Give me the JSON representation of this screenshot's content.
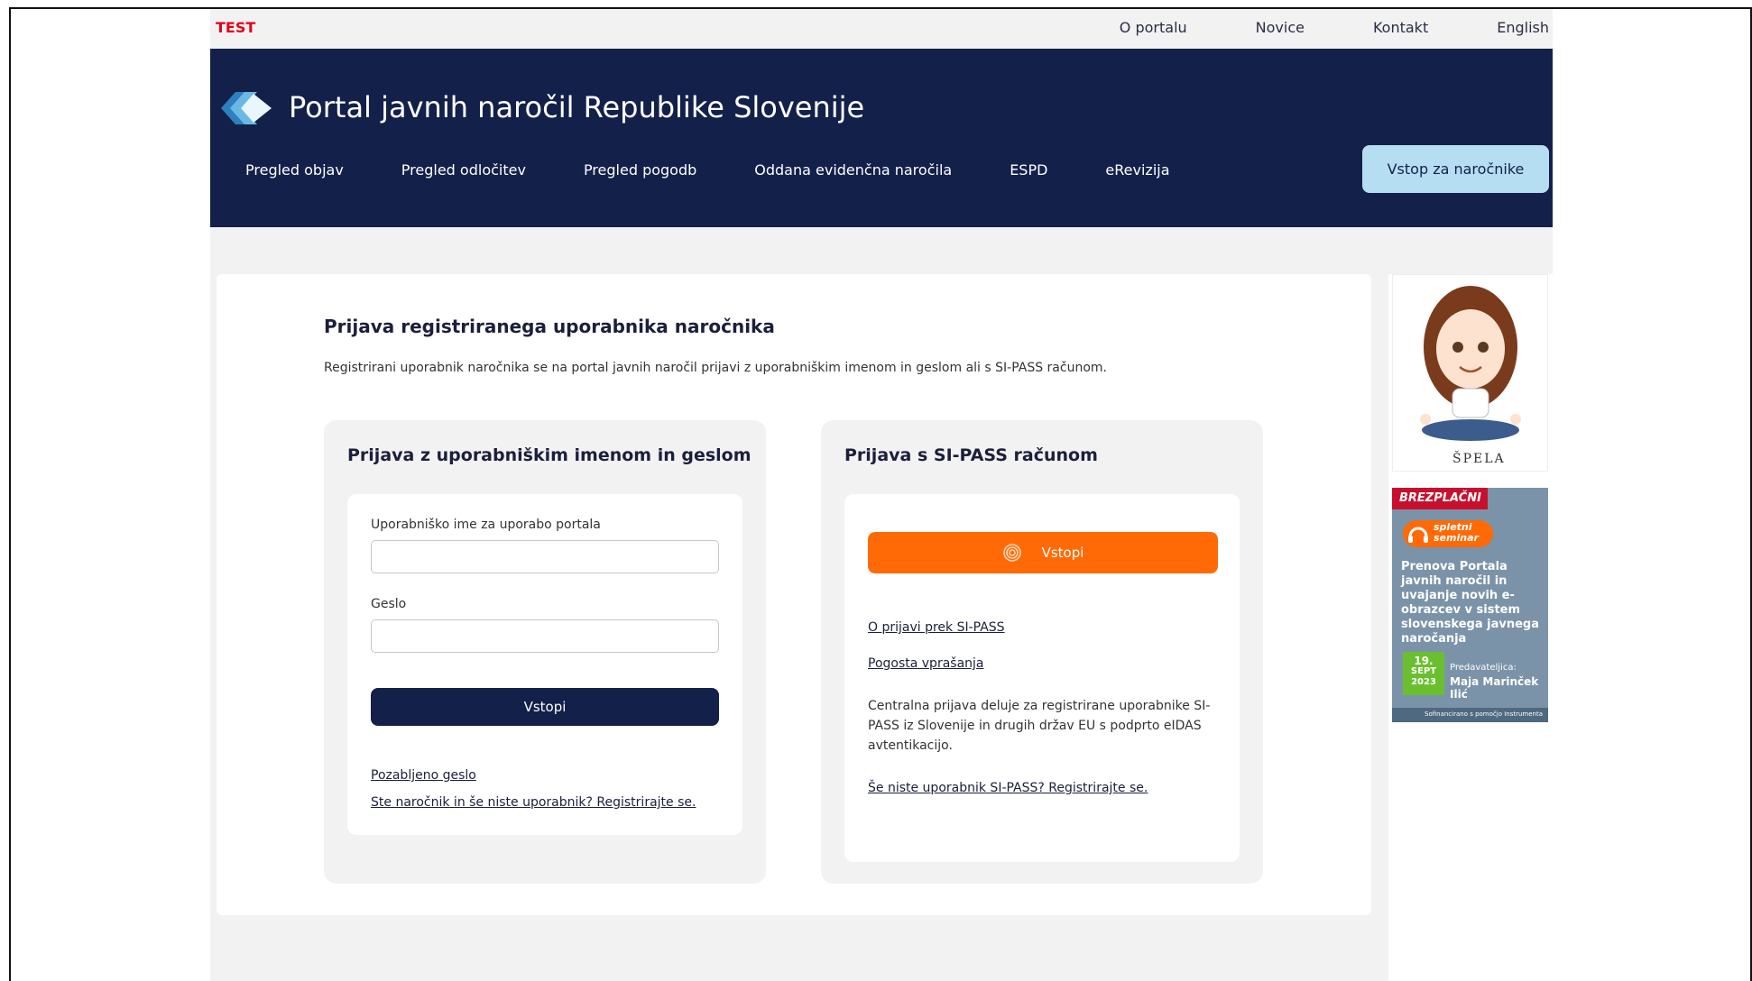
{
  "topbar": {
    "env_label": "TEST",
    "links": [
      "O portalu",
      "Novice",
      "Kontakt",
      "English"
    ]
  },
  "header": {
    "title": "Portal javnih naročil Republike Slovenije",
    "nav": [
      "Pregled objav",
      "Pregled odločitev",
      "Pregled pogodb",
      "Oddana evidenčna naročila",
      "ESPD",
      "eRevizija"
    ],
    "cta_label": "Vstop za naročnike"
  },
  "main": {
    "title": "Prijava registriranega uporabnika naročnika",
    "description": "Registrirani uporabnik naročnika se na portal javnih naročil prijavi z uporabniškim imenom in geslom ali s SI-PASS računom.",
    "login_panel": {
      "title": "Prijava z uporabniškim imenom in geslom",
      "username_label": "Uporabniško ime za uporabo portala",
      "username_value": "",
      "password_label": "Geslo",
      "password_value": "",
      "submit_label": "Vstopi",
      "forgot_link": "Pozabljeno geslo",
      "register_link": "Ste naročnik in še niste uporabnik? Registrirajte se."
    },
    "sipass_panel": {
      "title": "Prijava s SI-PASS računom",
      "submit_label": "Vstopi",
      "about_link": "O prijavi prek SI-PASS",
      "faq_link": "Pogosta vprašanja",
      "info_text": "Centralna prijava deluje za registrirane uporabnike SI-PASS iz Slovenije in drugih držav EU s podprto eIDAS avtentikacijo.",
      "register_link": "Še niste uporabnik SI-PASS? Registrirajte se."
    }
  },
  "sidebar": {
    "mascot_name": "ŠPELA",
    "promo": {
      "badge": "BREZPLAČNI",
      "pill": "spletni seminar",
      "title": "Prenova Portala javnih naročil in uvajanje novih e-obrazcev v sistem slovenskega javnega naročanja",
      "date_day": "19.",
      "date_month": "SEPT",
      "date_year": "2023",
      "speaker_label": "Predavateljica:",
      "speaker_name": "Maja Marinček Ilić",
      "footer": "Sofinancirano s pomočjo Instrumenta"
    }
  },
  "colors": {
    "header_bg": "#13204a",
    "accent_light": "#b6def2",
    "sipass_orange": "#ff6a06",
    "test_red": "#e3001b"
  }
}
